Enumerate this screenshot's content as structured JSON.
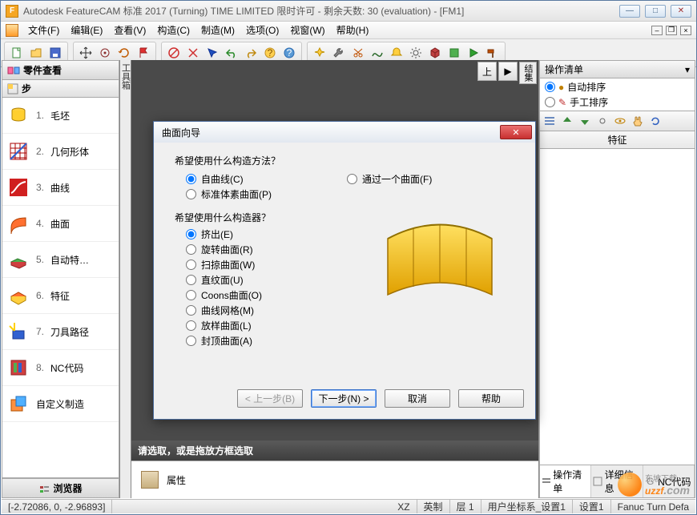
{
  "window": {
    "title": "Autodesk FeatureCAM 标准 2017 (Turning) TIME LIMITED 限时许可 - 剩余天数: 30 (evaluation) - [FM1]",
    "app_icon_letter": "F"
  },
  "menu": {
    "items": [
      "文件(F)",
      "编辑(E)",
      "查看(V)",
      "构造(C)",
      "制造(M)",
      "选项(O)",
      "视窗(W)",
      "帮助(H)"
    ]
  },
  "left_panel": {
    "title": "零件查看",
    "subtitle": "步",
    "steps": [
      {
        "num": "1.",
        "label": "毛坯"
      },
      {
        "num": "2.",
        "label": "几何形体"
      },
      {
        "num": "3.",
        "label": "曲线"
      },
      {
        "num": "4.",
        "label": "曲面"
      },
      {
        "num": "5.",
        "label": "自动特…"
      },
      {
        "num": "6.",
        "label": "特征"
      },
      {
        "num": "7.",
        "label": "刀具路径"
      },
      {
        "num": "8.",
        "label": "NC代码"
      },
      {
        "num": "",
        "label": "自定义制造"
      }
    ],
    "footer": "浏览器"
  },
  "splitter_label": "工具箱",
  "canvas_top": {
    "btn_up": "上",
    "btn_play": "▶",
    "label": "结集"
  },
  "right_panel": {
    "title": "操作清单",
    "opt_auto": "自动排序",
    "opt_manual": "手工排序",
    "column": "特征",
    "tabs": [
      "操作清单",
      "详细信息",
      "NC代码"
    ]
  },
  "hint": "请选取，或是拖放方框选取",
  "property_label": "属性",
  "dialog": {
    "title": "曲面向导",
    "q1": "希望使用什么构造方法？",
    "m1": "自曲线(C)",
    "m2": "通过一个曲面(F)",
    "m3": "标准体素曲面(P)",
    "q2": "希望使用什么构造器？",
    "c1": "挤出(E)",
    "c2": "旋转曲面(R)",
    "c3": "扫掠曲面(W)",
    "c4": "直纹面(U)",
    "c5": "Coons曲面(O)",
    "c6": "曲线网格(M)",
    "c7": "放样曲面(L)",
    "c8": "封顶曲面(A)",
    "btn_back": "< 上一步(B)",
    "btn_next": "下一步(N) >",
    "btn_cancel": "取消",
    "btn_help": "帮助"
  },
  "status": {
    "coords": "[-2.72086, 0, -2.96893]",
    "plane": "XZ",
    "ime": "英制",
    "layer": "层 1",
    "ucs": "用户坐标系_设置1",
    "setup": "设置1",
    "post": "Fanuc Turn Defa"
  },
  "watermark": {
    "host": "uzzf",
    "domain": ".com",
    "sub": "东坡下载"
  }
}
